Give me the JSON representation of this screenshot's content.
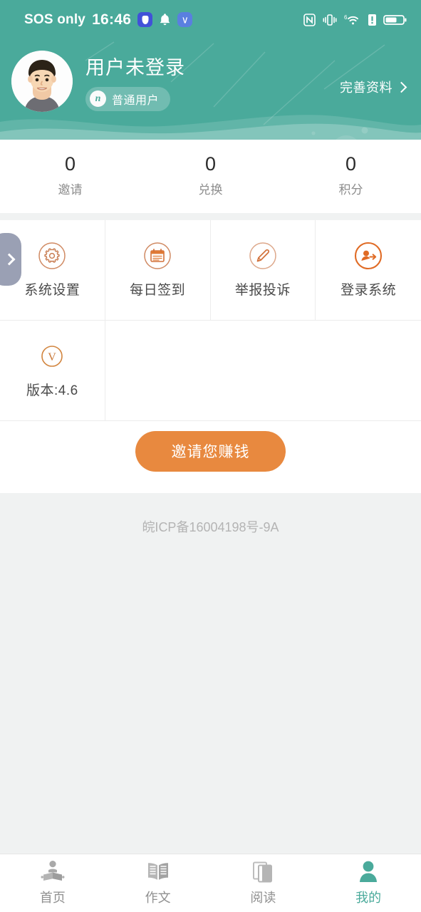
{
  "status_bar": {
    "carrier": "SOS only",
    "time": "16:46",
    "left_icons": [
      "shield-icon",
      "bell-icon",
      "vmail-icon"
    ],
    "right_icons": [
      "nfc-icon",
      "vibrate-icon",
      "wifi-6-icon",
      "sim-alert-icon",
      "battery-icon"
    ]
  },
  "header": {
    "bg_color": "#4aaa9b",
    "avatar_alt": "user-avatar",
    "username": "用户未登录",
    "badge_mark": "n",
    "badge_label": "普通用户",
    "profile_link": "完善资料"
  },
  "stats": [
    {
      "value": "0",
      "label": "邀请"
    },
    {
      "value": "0",
      "label": "兑换"
    },
    {
      "value": "0",
      "label": "积分"
    }
  ],
  "side_tab": {
    "icon": "chevron-right-icon"
  },
  "grid": [
    {
      "icon": "gear-icon",
      "label": "系统设置"
    },
    {
      "icon": "calendar-icon",
      "label": "每日签到"
    },
    {
      "icon": "pencil-icon",
      "label": "举报投诉"
    },
    {
      "icon": "user-login-icon",
      "label": "登录系统"
    },
    {
      "icon": "version-icon",
      "label": "版本:4.6"
    }
  ],
  "cta": {
    "label": "邀请您赚钱",
    "color": "#e8893f"
  },
  "footer": {
    "icp": "皖ICP备16004198号-9A"
  },
  "tabbar": {
    "accent_color": "#4aaa9b",
    "items": [
      {
        "icon": "home-reader-icon",
        "label": "首页",
        "active": false
      },
      {
        "icon": "open-book-icon",
        "label": "作文",
        "active": false
      },
      {
        "icon": "pages-icon",
        "label": "阅读",
        "active": false
      },
      {
        "icon": "person-icon",
        "label": "我的",
        "active": true
      }
    ]
  }
}
